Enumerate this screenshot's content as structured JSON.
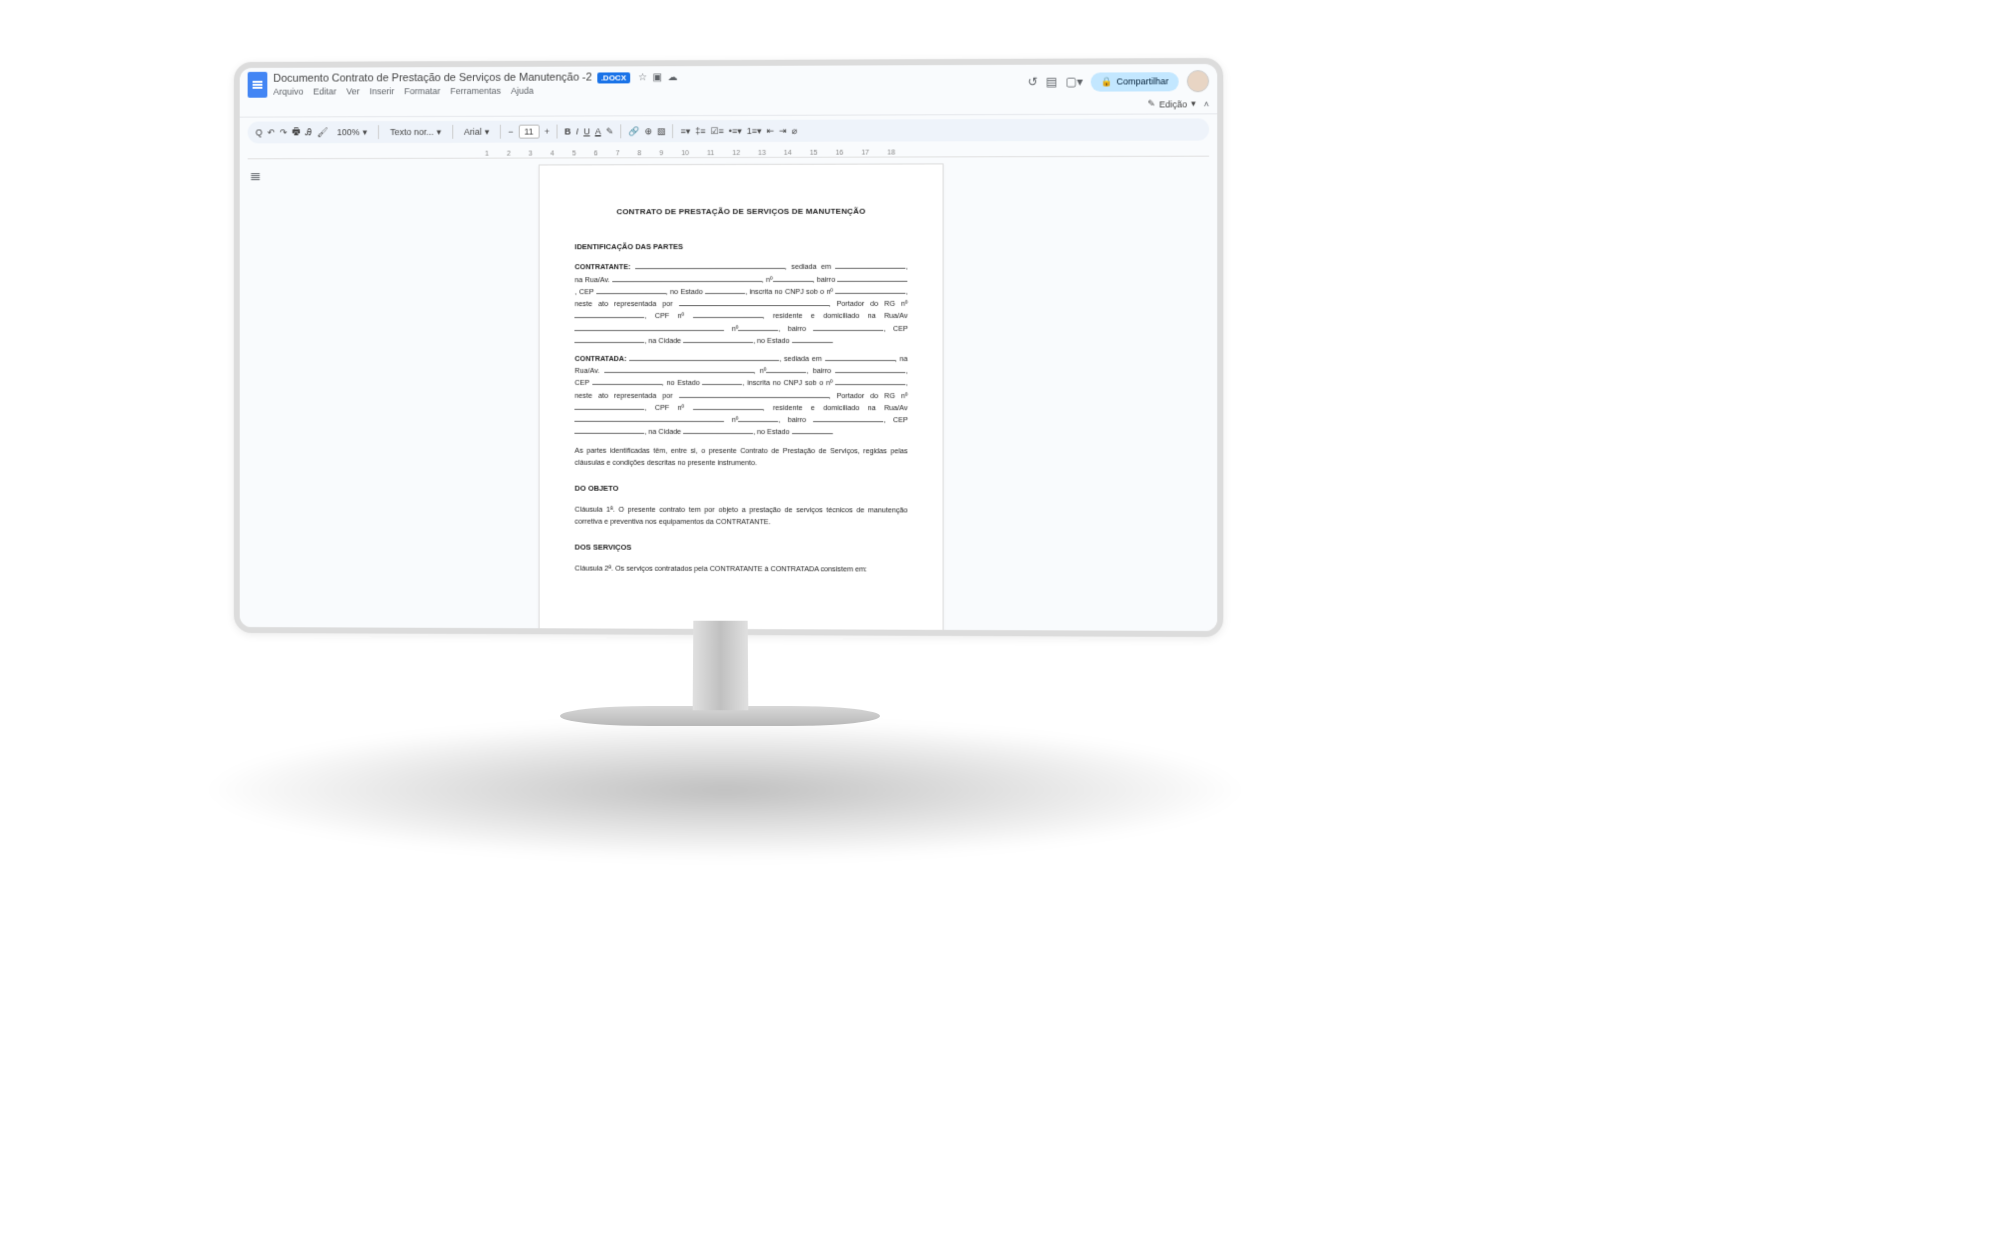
{
  "header": {
    "doc_name": "Documento Contrato de Prestação de Serviços de Manutenção -2",
    "docx_badge": ".DOCX",
    "menus": [
      "Arquivo",
      "Editar",
      "Ver",
      "Inserir",
      "Formatar",
      "Ferramentas",
      "Ajuda"
    ],
    "share_label": "Compartilhar",
    "edit_mode": "Edição"
  },
  "toolbar": {
    "zoom": "100%",
    "style": "Texto nor...",
    "font": "Arial",
    "font_size": "11"
  },
  "ruler": [
    "1",
    "2",
    "3",
    "4",
    "5",
    "6",
    "7",
    "8",
    "9",
    "10",
    "11",
    "12",
    "13",
    "14",
    "15",
    "16",
    "17",
    "18"
  ],
  "document": {
    "title": "CONTRATO DE PRESTAÇÃO DE SERVIÇOS DE MANUTENÇÃO",
    "sec1": "IDENTIFICAÇÃO DAS PARTES",
    "contratante_label": "CONTRATANTE:",
    "contratada_label": "CONTRATADA:",
    "party_block": {
      "sediada": ", sediada em",
      "rua": ", na Rua/Av.",
      "no": ", nº",
      "bairro": ", bairro",
      "cep": ", CEP",
      "estado": ", no Estado",
      "cnpj": ", inscrita no CNPJ sob o nº",
      "repr": ", neste ato representada por",
      "rg": "Portador do RG nº",
      "cpf": ", CPF nº",
      "domic": ", residente e domiciliado na Rua/Av",
      "no2": "nº",
      "bairro2": ", bairro",
      "cep2": "CEP",
      "cidade": ", na Cidade",
      "estado2": ", no Estado"
    },
    "intro": "As partes identificadas têm, entre si, o presente Contrato de Prestação de Serviços, regidas pelas cláusulas e condições descritas no presente instrumento.",
    "sec2": "DO OBJETO",
    "clause1": "Cláusula 1ª. O presente contrato tem por objeto a prestação de serviços técnicos de manutenção corretiva e preventiva nos equipamentos da CONTRATANTE.",
    "sec3": "DOS SERVIÇOS",
    "clause2": "Cláusula 2ª. Os serviços contratados pela CONTRATANTE à CONTRATADA consistem em:"
  }
}
